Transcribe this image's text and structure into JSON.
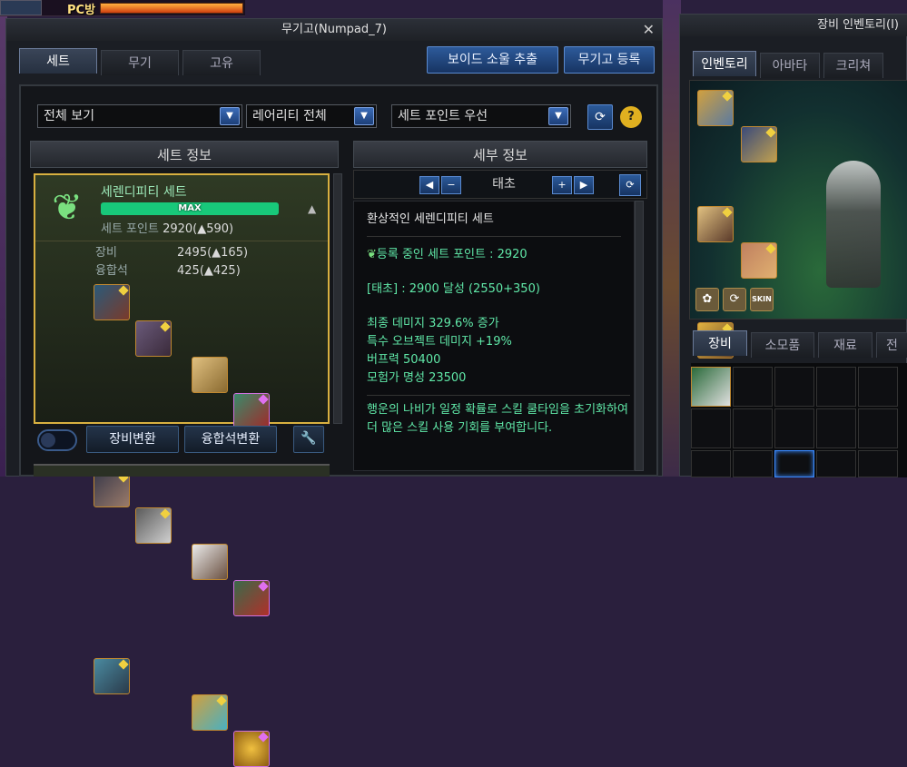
{
  "pc_bar": {
    "label": "PC방"
  },
  "window": {
    "title": "무기고(Numpad_7)"
  },
  "tabs": [
    {
      "label": "세트",
      "active": true
    },
    {
      "label": "무기",
      "active": false
    },
    {
      "label": "고유",
      "active": false
    }
  ],
  "top_buttons": {
    "extract": "보이드 소울 추출",
    "register": "무기고 등록"
  },
  "filters": {
    "view": "전체 보기",
    "rarity": "레어리티 전체",
    "sort": "세트 포인트 우선"
  },
  "set_info": {
    "header": "세트 정보",
    "set_name": "세렌디피티 세트",
    "bar_label": "MAX",
    "point_label": "세트 포인트",
    "point_value": "2920(▲590)",
    "equip_label": "장비",
    "equip_value": "2495(▲165)",
    "fusion_label": "융합석",
    "fusion_value": "425(▲425)",
    "btn_equip_change": "장비변환",
    "btn_fusion_change": "융합석변환"
  },
  "detail": {
    "header": "세부 정보",
    "stage": "태초",
    "title": "환상적인 세렌디피티 세트",
    "registered": "등록 중인 세트 포인트 : 2920",
    "achieved": "[태초] : 2900 달성 (2550+350)",
    "effects": [
      "최종 데미지 329.6% 증가",
      "특수 오브젝트 데미지 +19%",
      "버프력 50400",
      "모험가 명성 23500"
    ],
    "desc": "행운의 나비가 일정 확률로 스킬 쿨타임을 초기화하여 더 많은 스킬 사용 기회를 부여합니다."
  },
  "right_window": {
    "title": "장비 인벤토리(I)",
    "tabs": [
      "인벤토리",
      "아바타",
      "크리쳐"
    ],
    "bottom_tabs": [
      "장비",
      "소모품",
      "재료",
      "전"
    ],
    "skin_label": "SKIN"
  },
  "colors": {
    "accent_blue": "#2d5a9a",
    "set_gold": "#d8b040",
    "bar_green": "#18c87a",
    "text_green": "#60e8a8"
  }
}
